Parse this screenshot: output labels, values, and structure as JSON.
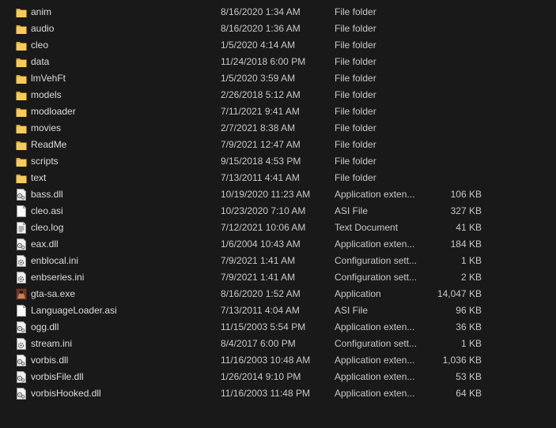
{
  "files": [
    {
      "name": "anim",
      "date": "8/16/2020 1:34 AM",
      "type": "File folder",
      "size": "",
      "icon": "folder-icon"
    },
    {
      "name": "audio",
      "date": "8/16/2020 1:36 AM",
      "type": "File folder",
      "size": "",
      "icon": "folder-icon"
    },
    {
      "name": "cleo",
      "date": "1/5/2020 4:14 AM",
      "type": "File folder",
      "size": "",
      "icon": "folder-icon"
    },
    {
      "name": "data",
      "date": "11/24/2018 6:00 PM",
      "type": "File folder",
      "size": "",
      "icon": "folder-icon"
    },
    {
      "name": "lmVehFt",
      "date": "1/5/2020 3:59 AM",
      "type": "File folder",
      "size": "",
      "icon": "folder-icon"
    },
    {
      "name": "models",
      "date": "2/26/2018 5:12 AM",
      "type": "File folder",
      "size": "",
      "icon": "folder-icon"
    },
    {
      "name": "modloader",
      "date": "7/11/2021 9:41 AM",
      "type": "File folder",
      "size": "",
      "icon": "folder-icon"
    },
    {
      "name": "movies",
      "date": "2/7/2021 8:38 AM",
      "type": "File folder",
      "size": "",
      "icon": "folder-icon"
    },
    {
      "name": "ReadMe",
      "date": "7/9/2021 12:47 AM",
      "type": "File folder",
      "size": "",
      "icon": "folder-icon"
    },
    {
      "name": "scripts",
      "date": "9/15/2018 4:53 PM",
      "type": "File folder",
      "size": "",
      "icon": "folder-icon"
    },
    {
      "name": "text",
      "date": "7/13/2011 4:41 AM",
      "type": "File folder",
      "size": "",
      "icon": "folder-icon"
    },
    {
      "name": "bass.dll",
      "date": "10/19/2020 11:23 AM",
      "type": "Application exten...",
      "size": "106 KB",
      "icon": "dll-file-icon"
    },
    {
      "name": "cleo.asi",
      "date": "10/23/2020 7:10 AM",
      "type": "ASI File",
      "size": "327 KB",
      "icon": "blank-file-icon"
    },
    {
      "name": "cleo.log",
      "date": "7/12/2021 10:06 AM",
      "type": "Text Document",
      "size": "41 KB",
      "icon": "text-file-icon"
    },
    {
      "name": "eax.dll",
      "date": "1/6/2004 10:43 AM",
      "type": "Application exten...",
      "size": "184 KB",
      "icon": "dll-file-icon"
    },
    {
      "name": "enblocal.ini",
      "date": "7/9/2021 1:41 AM",
      "type": "Configuration sett...",
      "size": "1 KB",
      "icon": "config-file-icon"
    },
    {
      "name": "enbseries.ini",
      "date": "7/9/2021 1:41 AM",
      "type": "Configuration sett...",
      "size": "2 KB",
      "icon": "config-file-icon"
    },
    {
      "name": "gta-sa.exe",
      "date": "8/16/2020 1:52 AM",
      "type": "Application",
      "size": "14,047 KB",
      "icon": "app-exe-icon"
    },
    {
      "name": "LanguageLoader.asi",
      "date": "7/13/2011 4:04 AM",
      "type": "ASI File",
      "size": "96 KB",
      "icon": "blank-file-icon"
    },
    {
      "name": "ogg.dll",
      "date": "11/15/2003 5:54 PM",
      "type": "Application exten...",
      "size": "36 KB",
      "icon": "dll-file-icon"
    },
    {
      "name": "stream.ini",
      "date": "8/4/2017 6:00 PM",
      "type": "Configuration sett...",
      "size": "1 KB",
      "icon": "config-file-icon"
    },
    {
      "name": "vorbis.dll",
      "date": "11/16/2003 10:48 AM",
      "type": "Application exten...",
      "size": "1,036 KB",
      "icon": "dll-file-icon"
    },
    {
      "name": "vorbisFile.dll",
      "date": "1/26/2014 9:10 PM",
      "type": "Application exten...",
      "size": "53 KB",
      "icon": "dll-file-icon"
    },
    {
      "name": "vorbisHooked.dll",
      "date": "11/16/2003 11:48 PM",
      "type": "Application exten...",
      "size": "64 KB",
      "icon": "dll-file-icon"
    }
  ],
  "colors": {
    "background": "#191919",
    "text": "#dcdcdc",
    "folder": "#f3c553"
  }
}
